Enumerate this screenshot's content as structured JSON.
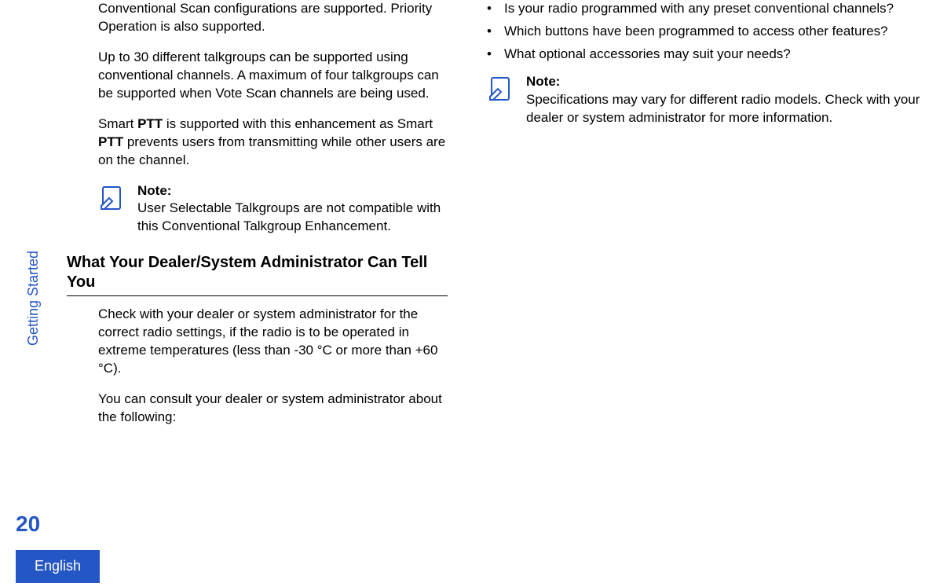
{
  "side_label": "Getting Started",
  "page_number": "20",
  "lang": "English",
  "col1": {
    "p1": "Conventional Scan configurations are supported. Priority Operation is also supported.",
    "p2": "Up to 30 different talkgroups can be supported using conventional channels. A maximum of four talkgroups can be supported when Vote Scan channels are being used.",
    "p3a": "Smart ",
    "p3b": "PTT",
    "p3c": " is supported with this enhancement as Smart ",
    "p3d": "PTT",
    "p3e": " prevents users from transmitting while other users are on the channel.",
    "note_title": "Note:",
    "note_body": "User Selectable Talkgroups are not compatible with this Conventional Talkgroup Enhancement.",
    "heading": "What Your Dealer/System Administrator Can Tell You",
    "p4": "Check with your dealer or system administrator for the correct radio settings, if the radio is to be operated in extreme temperatures (less than -30 °C or more than +60 °C).",
    "p5": "You can consult your dealer or system administrator about the following:"
  },
  "col2": {
    "bullets": [
      "Is your radio programmed with any preset conventional channels?",
      "Which buttons have been programmed to access other features?",
      "What optional accessories may suit your needs?"
    ],
    "note_title": "Note:",
    "note_body": "Specifications may vary for different radio models. Check with your dealer or system administrator for more information."
  }
}
